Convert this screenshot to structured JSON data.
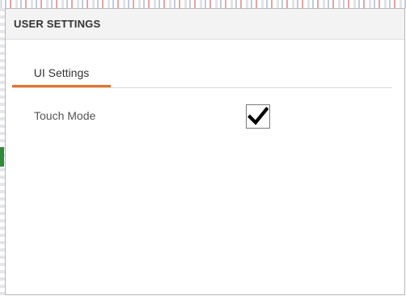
{
  "dialog": {
    "title": "USER SETTINGS"
  },
  "tabs": [
    {
      "label": "UI Settings",
      "active": true
    }
  ],
  "settings": [
    {
      "label": "Touch Mode",
      "checked": true
    }
  ],
  "colors": {
    "accent": "#e8742a",
    "header_bg": "#f3f3f3",
    "check": "#000000"
  },
  "icons": {
    "checkbox_mark": "checkmark-icon"
  }
}
